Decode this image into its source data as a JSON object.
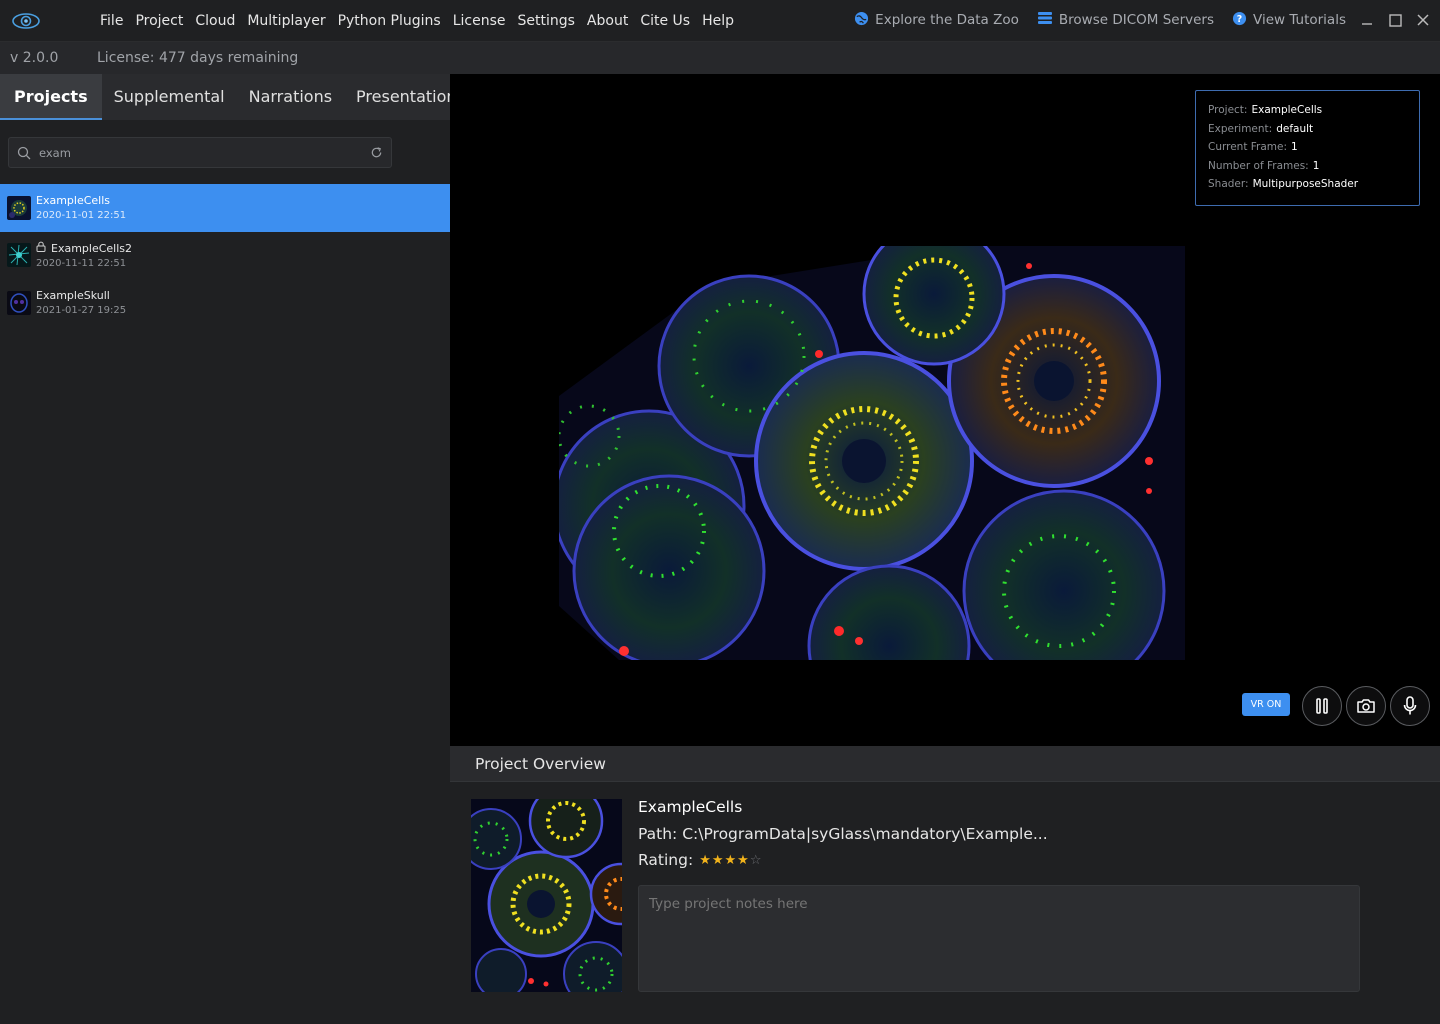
{
  "menu": [
    "File",
    "Project",
    "Cloud",
    "Multiplayer",
    "Python Plugins",
    "License",
    "Settings",
    "About",
    "Cite Us",
    "Help"
  ],
  "top_links": {
    "data_zoo": "Explore the Data Zoo",
    "dicom": "Browse DICOM Servers",
    "tutorials": "View Tutorials"
  },
  "version": "v 2.0.0",
  "license": "License: 477 days remaining",
  "tabs": [
    "Projects",
    "Supplemental",
    "Narrations",
    "Presentations"
  ],
  "search": {
    "value": "exam"
  },
  "projects": [
    {
      "name": "ExampleCells",
      "date": "2020-11-01 22:51",
      "selected": true,
      "locked": false
    },
    {
      "name": "ExampleCells2",
      "date": "2020-11-11 22:51",
      "selected": false,
      "locked": true
    },
    {
      "name": "ExampleSkull",
      "date": "2021-01-27 19:25",
      "selected": false,
      "locked": false
    }
  ],
  "info": {
    "project_label": "Project:",
    "project": "ExampleCells",
    "experiment_label": "Experiment:",
    "experiment": "default",
    "frame_label": "Current Frame:",
    "frame": "1",
    "frames_label": "Number of Frames:",
    "frames": "1",
    "shader_label": "Shader:",
    "shader": "MultipurposeShader"
  },
  "vr_button": "VR ON",
  "overview": {
    "header": "Project Overview",
    "name": "ExampleCells",
    "path": "Path: C:\\ProgramData|syGlass\\mandatory\\Example...",
    "rating_label": "Rating:",
    "rating": 4,
    "rating_max": 5,
    "notes_placeholder": "Type project notes here"
  },
  "colors": {
    "accent": "#3d8ff0",
    "background": "#1f2022",
    "star": "#f2b31b"
  }
}
